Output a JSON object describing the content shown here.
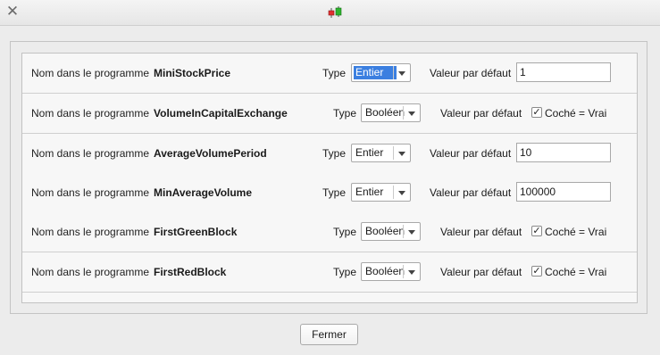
{
  "window": {
    "close_icon": "close-icon",
    "app_icon": "candlestick-chart-icon"
  },
  "labels": {
    "name_prefix": "Nom dans le programme",
    "type": "Type",
    "default_value": "Valeur par défaut"
  },
  "params": [
    {
      "name": "MiniStockPrice",
      "type": "Entier",
      "default": "1",
      "selected": true
    },
    {
      "name": "VolumeInCapitalExchange",
      "type": "Booléen",
      "checked": true,
      "check_label": "Coché = Vrai"
    },
    {
      "name": "AverageVolumePeriod",
      "type": "Entier",
      "default": "10"
    },
    {
      "name": "MinAverageVolume",
      "type": "Entier",
      "default": "100000"
    },
    {
      "name": "FirstGreenBlock",
      "type": "Booléen",
      "checked": true,
      "check_label": "Coché = Vrai"
    },
    {
      "name": "FirstRedBlock",
      "type": "Booléen",
      "checked": true,
      "check_label": "Coché = Vrai"
    }
  ],
  "footer": {
    "close_label": "Fermer"
  },
  "colors": {
    "selection": "#3b7fe0",
    "candle_up": "#2db52d",
    "candle_down": "#e03030"
  }
}
